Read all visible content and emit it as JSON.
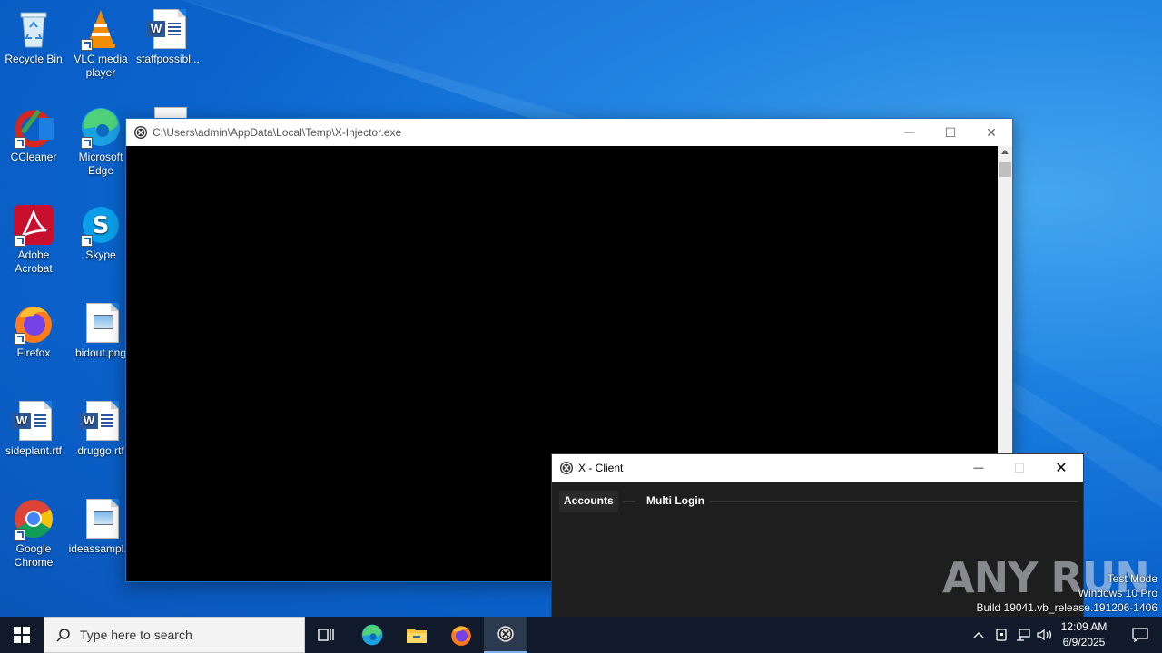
{
  "desktop": {
    "icons": [
      {
        "label": "Recycle Bin",
        "icon": "recycle-bin-icon"
      },
      {
        "label": "VLC media\nplayer",
        "icon": "vlc-icon"
      },
      {
        "label": "staffpossibl...",
        "icon": "word-doc-icon"
      },
      {
        "label": "CCleaner",
        "icon": "ccleaner-icon"
      },
      {
        "label": "Microsoft\nEdge",
        "icon": "edge-icon"
      },
      {
        "label": "Adobe\nAcrobat",
        "icon": "acrobat-icon"
      },
      {
        "label": "Skype",
        "icon": "skype-icon"
      },
      {
        "label": "Firefox",
        "icon": "firefox-icon"
      },
      {
        "label": "bidout.png",
        "icon": "image-file-icon"
      },
      {
        "label": "sideplant.rtf",
        "icon": "word-doc-icon"
      },
      {
        "label": "druggo.rtf",
        "icon": "word-doc-icon"
      },
      {
        "label": "Google\nChrome",
        "icon": "chrome-icon"
      },
      {
        "label": "ideassampl...",
        "icon": "image-file-icon"
      }
    ]
  },
  "console_window": {
    "title": "C:\\Users\\admin\\AppData\\Local\\Temp\\X-Injector.exe",
    "minimize": "—",
    "maximize": "☐",
    "close": "✕"
  },
  "client_window": {
    "title": "X - Client",
    "minimize": "—",
    "maximize": "☐",
    "close": "✕",
    "tabs": [
      "Accounts",
      "Multi Login"
    ]
  },
  "taskbar": {
    "search_placeholder": "Type here to search",
    "time": "12:09 AM",
    "date": "6/9/2025"
  },
  "watermark": {
    "line1": "Test Mode",
    "line2": "Windows 10 Pro",
    "line3": "Build 19041.vb_release.191206-1406",
    "brand": "ANY RUN"
  },
  "colors": {
    "desktop": "#0a63cc",
    "console_bg": "#000000",
    "client_bg": "#1e1e1e",
    "taskbar": "#101a2a"
  }
}
